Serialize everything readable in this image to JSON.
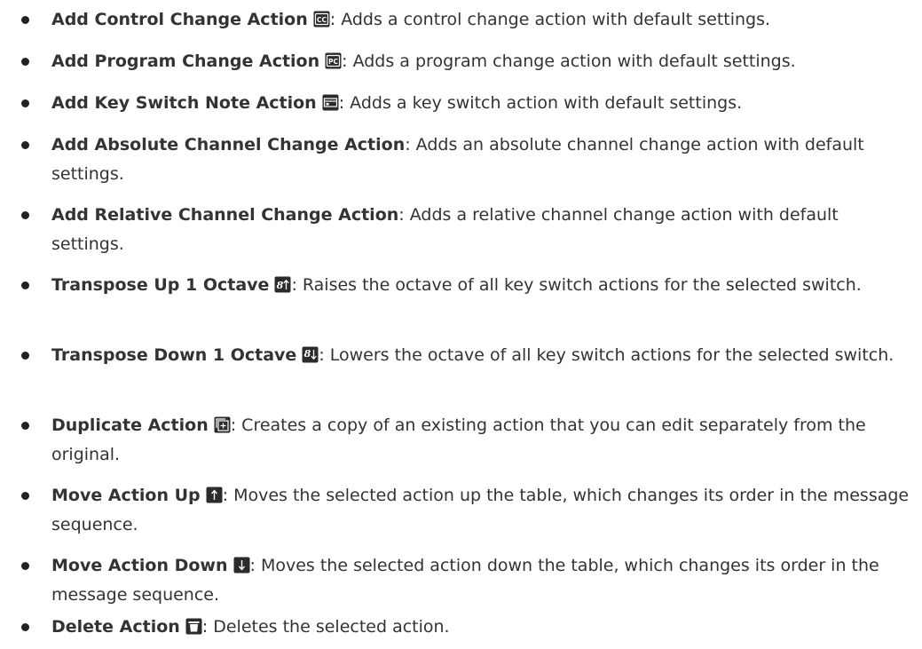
{
  "items": [
    {
      "term": "Add Control Change Action",
      "icon": "control-change-icon",
      "desc": ": Adds a control change action with default settings."
    },
    {
      "term": "Add Program Change Action",
      "icon": "program-change-icon",
      "desc": ": Adds a program change action with default settings."
    },
    {
      "term": "Add Key Switch Note Action",
      "icon": "key-switch-icon",
      "desc": ": Adds a key switch action with default settings."
    },
    {
      "term": "Add Absolute Channel Change Action",
      "icon": "",
      "desc": ": Adds an absolute channel change action with default settings."
    },
    {
      "term": "Add Relative Channel Change Action",
      "icon": "",
      "desc": ": Adds a relative channel change action with default settings."
    },
    {
      "term": "Transpose Up 1 Octave",
      "icon": "transpose-up-icon",
      "desc": ": Raises the octave of all key switch actions for the selected switch."
    },
    {
      "term": "Transpose Down 1 Octave",
      "icon": "transpose-down-icon",
      "desc": ": Lowers the octave of all key switch actions for the selected switch."
    },
    {
      "term": "Duplicate Action",
      "icon": "duplicate-icon",
      "desc": ": Creates a copy of an existing action that you can edit separately from the original."
    },
    {
      "term": "Move Action Up",
      "icon": "arrow-up-icon",
      "desc": ": Moves the selected action up the table, which changes its order in the message sequence."
    },
    {
      "term": "Move Action Down",
      "icon": "arrow-down-icon",
      "desc": ": Moves the selected action down the table, which changes its order in the message sequence."
    },
    {
      "term": "Delete Action",
      "icon": "trash-icon",
      "desc": ": Deletes the selected action."
    }
  ],
  "icon_labels": {
    "control_change": "CC",
    "program_change": "PC"
  },
  "colors": {
    "text": "#333333",
    "icon_bg": "#2b2b2b",
    "icon_fg": "#ffffff"
  }
}
